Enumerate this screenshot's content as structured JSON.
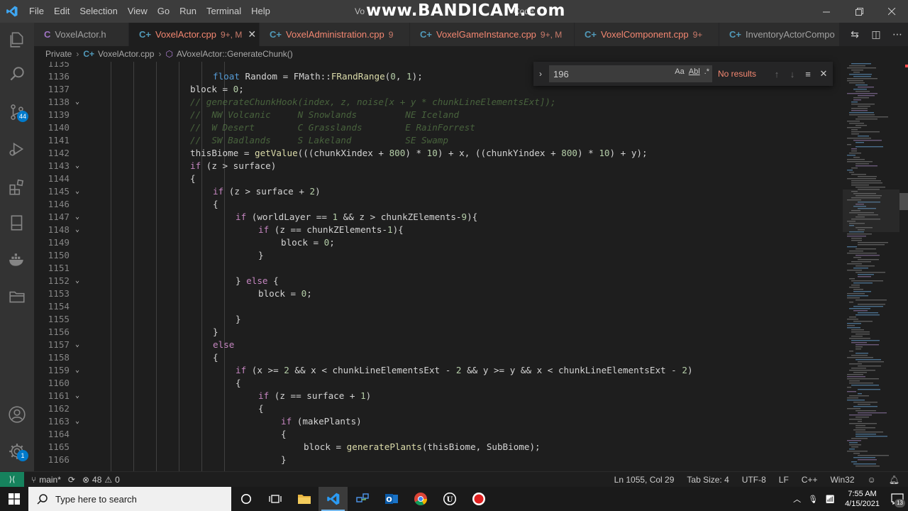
{
  "window": {
    "title_left": "Vo",
    "title_right": "Code",
    "watermark": "www.BANDICAM.com"
  },
  "menu": [
    "File",
    "Edit",
    "Selection",
    "View",
    "Go",
    "Run",
    "Terminal",
    "Help"
  ],
  "tabs": [
    {
      "icon": "C",
      "name": "VoxelActor.h",
      "status": "",
      "active": false,
      "modified": false
    },
    {
      "icon": "C+",
      "name": "VoxelActor.cpp",
      "status": "9+, M",
      "active": true,
      "modified": true
    },
    {
      "icon": "C+",
      "name": "VoxelAdministration.cpp",
      "status": "9",
      "active": false,
      "modified": true
    },
    {
      "icon": "C+",
      "name": "VoxelGameInstance.cpp",
      "status": "9+, M",
      "active": false,
      "modified": true
    },
    {
      "icon": "C+",
      "name": "VoxelComponent.cpp",
      "status": "9+",
      "active": false,
      "modified": true
    },
    {
      "icon": "C+",
      "name": "InventoryActorCompo",
      "status": "",
      "active": false,
      "modified": false
    }
  ],
  "breadcrumb": {
    "folder": "Private",
    "file": "VoxelActor.cpp",
    "symbol": "AVoxelActor::GenerateChunk()"
  },
  "find": {
    "query": "196",
    "result": "No results",
    "match_case_label": "Aa",
    "whole_word_label": "Abl",
    "regex_label": ".*"
  },
  "editor": {
    "lines": [
      {
        "n": "1135",
        "fold": false,
        "indent": 0,
        "tokens": [
          [
            "",
            "id"
          ]
        ]
      },
      {
        "n": "1136",
        "fold": false,
        "indent": 2,
        "tokens": [
          [
            "float",
            "kw"
          ],
          [
            " Random = FMath::",
            "id"
          ],
          [
            "FRandRange",
            "fn"
          ],
          [
            "(",
            "op"
          ],
          [
            "0",
            "num"
          ],
          [
            ", ",
            "op"
          ],
          [
            "1",
            "num"
          ],
          [
            ");",
            "op"
          ]
        ]
      },
      {
        "n": "1137",
        "fold": false,
        "indent": 1,
        "tokens": [
          [
            "block = ",
            "id"
          ],
          [
            "0",
            "num"
          ],
          [
            ";",
            "op"
          ]
        ]
      },
      {
        "n": "1138",
        "fold": true,
        "indent": 1,
        "tokens": [
          [
            "// generateChunkHook(index, z, noise[x + y * chunkLineElementsExt]);",
            "cm"
          ]
        ]
      },
      {
        "n": "1139",
        "fold": false,
        "indent": 1,
        "tokens": [
          [
            "//  NW Volcanic     N Snowlands         NE Iceland",
            "cm"
          ]
        ]
      },
      {
        "n": "1140",
        "fold": false,
        "indent": 1,
        "tokens": [
          [
            "//  W Desert        C Grasslands        E RainForrest",
            "cm"
          ]
        ]
      },
      {
        "n": "1141",
        "fold": false,
        "indent": 1,
        "tokens": [
          [
            "//  SW Badlands     S Lakeland          SE Swamp",
            "cm"
          ]
        ]
      },
      {
        "n": "1142",
        "fold": false,
        "indent": 1,
        "tokens": [
          [
            "thisBiome = ",
            "id"
          ],
          [
            "getValue",
            "fn"
          ],
          [
            "(((chunkXindex + ",
            "id"
          ],
          [
            "800",
            "num"
          ],
          [
            ") * ",
            "op"
          ],
          [
            "10",
            "num"
          ],
          [
            ") + x, ((chunkYindex + ",
            "id"
          ],
          [
            "800",
            "num"
          ],
          [
            ") * ",
            "op"
          ],
          [
            "10",
            "num"
          ],
          [
            ") + y);",
            "id"
          ]
        ]
      },
      {
        "n": "1143",
        "fold": true,
        "indent": 1,
        "tokens": [
          [
            "if",
            "ctl"
          ],
          [
            " (z > surface)",
            "id"
          ]
        ]
      },
      {
        "n": "1144",
        "fold": false,
        "indent": 1,
        "tokens": [
          [
            "{",
            "op"
          ]
        ]
      },
      {
        "n": "1145",
        "fold": true,
        "indent": 2,
        "tokens": [
          [
            "if",
            "ctl"
          ],
          [
            " (z > surface + ",
            "id"
          ],
          [
            "2",
            "num"
          ],
          [
            ")",
            "op"
          ]
        ]
      },
      {
        "n": "1146",
        "fold": false,
        "indent": 2,
        "tokens": [
          [
            "{",
            "op"
          ]
        ]
      },
      {
        "n": "1147",
        "fold": true,
        "indent": 3,
        "tokens": [
          [
            "if",
            "ctl"
          ],
          [
            " (worldLayer == ",
            "id"
          ],
          [
            "1",
            "num"
          ],
          [
            " && z > chunkZElements-",
            "id"
          ],
          [
            "9",
            "num"
          ],
          [
            "){",
            "op"
          ]
        ]
      },
      {
        "n": "1148",
        "fold": true,
        "indent": 4,
        "tokens": [
          [
            "if",
            "ctl"
          ],
          [
            " (z == chunkZElements-",
            "id"
          ],
          [
            "1",
            "num"
          ],
          [
            "){",
            "op"
          ]
        ]
      },
      {
        "n": "1149",
        "fold": false,
        "indent": 5,
        "tokens": [
          [
            "block = ",
            "id"
          ],
          [
            "0",
            "num"
          ],
          [
            ";",
            "op"
          ]
        ]
      },
      {
        "n": "1150",
        "fold": false,
        "indent": 4,
        "tokens": [
          [
            "}",
            "op"
          ]
        ]
      },
      {
        "n": "1151",
        "fold": false,
        "indent": 0,
        "tokens": [
          [
            "",
            "id"
          ]
        ]
      },
      {
        "n": "1152",
        "fold": true,
        "indent": 3,
        "tokens": [
          [
            "} ",
            "op"
          ],
          [
            "else",
            "ctl"
          ],
          [
            " {",
            "op"
          ]
        ]
      },
      {
        "n": "1153",
        "fold": false,
        "indent": 4,
        "tokens": [
          [
            "block = ",
            "id"
          ],
          [
            "0",
            "num"
          ],
          [
            ";",
            "op"
          ]
        ]
      },
      {
        "n": "1154",
        "fold": false,
        "indent": 0,
        "tokens": [
          [
            "",
            "id"
          ]
        ]
      },
      {
        "n": "1155",
        "fold": false,
        "indent": 3,
        "tokens": [
          [
            "}",
            "op"
          ]
        ]
      },
      {
        "n": "1156",
        "fold": false,
        "indent": 2,
        "tokens": [
          [
            "}",
            "op"
          ]
        ]
      },
      {
        "n": "1157",
        "fold": true,
        "indent": 2,
        "tokens": [
          [
            "else",
            "ctl"
          ]
        ]
      },
      {
        "n": "1158",
        "fold": false,
        "indent": 2,
        "tokens": [
          [
            "{",
            "op"
          ]
        ]
      },
      {
        "n": "1159",
        "fold": true,
        "indent": 3,
        "tokens": [
          [
            "if",
            "ctl"
          ],
          [
            " (x >= ",
            "id"
          ],
          [
            "2",
            "num"
          ],
          [
            " && x < chunkLineElementsExt - ",
            "id"
          ],
          [
            "2",
            "num"
          ],
          [
            " && y >= y && x < chunkLineElementsExt - ",
            "id"
          ],
          [
            "2",
            "num"
          ],
          [
            ")",
            "op"
          ]
        ]
      },
      {
        "n": "1160",
        "fold": false,
        "indent": 3,
        "tokens": [
          [
            "{",
            "op"
          ]
        ]
      },
      {
        "n": "1161",
        "fold": true,
        "indent": 4,
        "tokens": [
          [
            "if",
            "ctl"
          ],
          [
            " (z == surface + ",
            "id"
          ],
          [
            "1",
            "num"
          ],
          [
            ")",
            "op"
          ]
        ]
      },
      {
        "n": "1162",
        "fold": false,
        "indent": 4,
        "tokens": [
          [
            "{",
            "op"
          ]
        ]
      },
      {
        "n": "1163",
        "fold": true,
        "indent": 5,
        "tokens": [
          [
            "if",
            "ctl"
          ],
          [
            " (makePlants)",
            "id"
          ]
        ]
      },
      {
        "n": "1164",
        "fold": false,
        "indent": 5,
        "tokens": [
          [
            "{",
            "op"
          ]
        ]
      },
      {
        "n": "1165",
        "fold": false,
        "indent": 6,
        "tokens": [
          [
            "block = ",
            "id"
          ],
          [
            "generatePlants",
            "fn"
          ],
          [
            "(thisBiome, SubBiome);",
            "id"
          ]
        ]
      },
      {
        "n": "1166",
        "fold": false,
        "indent": 5,
        "tokens": [
          [
            "}",
            "op"
          ]
        ]
      }
    ]
  },
  "activity": [
    {
      "name": "explorer-icon",
      "badge": ""
    },
    {
      "name": "search-icon",
      "badge": ""
    },
    {
      "name": "source-control-icon",
      "badge": "44"
    },
    {
      "name": "run-debug-icon",
      "badge": ""
    },
    {
      "name": "extensions-icon",
      "badge": ""
    },
    {
      "name": "notebook-icon",
      "badge": ""
    },
    {
      "name": "docker-icon",
      "badge": ""
    },
    {
      "name": "folder-icon",
      "badge": ""
    },
    {
      "name": "account-icon",
      "badge": ""
    },
    {
      "name": "manage-gear-icon",
      "badge": "1"
    }
  ],
  "status": {
    "branch": "main*",
    "errors": "48",
    "warnings": "0",
    "position": "Ln 1055, Col 29",
    "tab_size": "Tab Size: 4",
    "encoding": "UTF-8",
    "eol": "LF",
    "language": "C++",
    "platform": "Win32"
  },
  "taskbar": {
    "search_placeholder": "Type here to search",
    "time": "7:55 AM",
    "date": "4/15/2021",
    "notification_count": "13",
    "apps": [
      "cortana-icon",
      "task-view-icon",
      "file-explorer-icon",
      "vscode-icon",
      "network-app-icon",
      "outlook-icon",
      "chrome-icon",
      "unreal-engine-icon",
      "bandicam-record-icon"
    ]
  },
  "colors": {
    "accent": "#007acc",
    "remote": "#16825d",
    "modified_tab": "#f48771"
  }
}
